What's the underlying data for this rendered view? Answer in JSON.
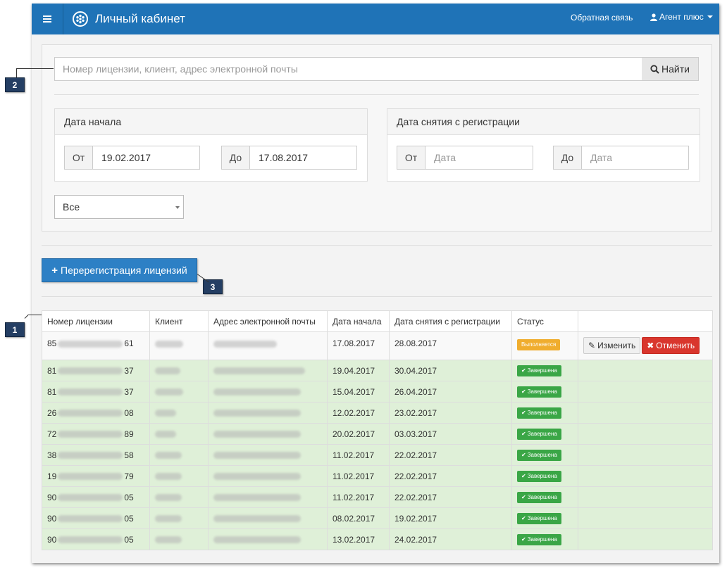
{
  "navbar": {
    "title": "Личный кабинет",
    "feedback": "Обратная связь",
    "user": "Агент плюс"
  },
  "search": {
    "placeholder": "Номер лицензии, клиент, адрес электронной почты",
    "button": "Найти"
  },
  "start_date": {
    "title": "Дата начала",
    "from_label": "От",
    "from_value": "19.02.2017",
    "to_label": "До",
    "to_value": "17.08.2017"
  },
  "dereg_date": {
    "title": "Дата снятия с регистрации",
    "from_label": "От",
    "from_placeholder": "Дата",
    "to_label": "До",
    "to_placeholder": "Дата"
  },
  "status_filter": {
    "value": "Все"
  },
  "rereg_button": "Перерегистрация лицензий",
  "table": {
    "headers": [
      "Номер лицензии",
      "Клиент",
      "Адрес электронной почты",
      "Дата начала",
      "Дата снятия с регистрации",
      "Статус",
      ""
    ],
    "rows": [
      {
        "lic_start": "85",
        "lic_end": "61",
        "start": "17.08.2017",
        "dereg": "28.08.2017",
        "status": "Выполняется",
        "state": "active"
      },
      {
        "lic_start": "81",
        "lic_end": "37",
        "start": "19.04.2017",
        "dereg": "30.04.2017",
        "status": "Завершена",
        "state": "done"
      },
      {
        "lic_start": "81",
        "lic_end": "37",
        "start": "15.04.2017",
        "dereg": "26.04.2017",
        "status": "Завершена",
        "state": "done"
      },
      {
        "lic_start": "26",
        "lic_end": "08",
        "start": "12.02.2017",
        "dereg": "23.02.2017",
        "status": "Завершена",
        "state": "done"
      },
      {
        "lic_start": "72",
        "lic_end": "89",
        "start": "20.02.2017",
        "dereg": "03.03.2017",
        "status": "Завершена",
        "state": "done"
      },
      {
        "lic_start": "38",
        "lic_end": "58",
        "start": "11.02.2017",
        "dereg": "22.02.2017",
        "status": "Завершена",
        "state": "done"
      },
      {
        "lic_start": "19",
        "lic_end": "79",
        "start": "11.02.2017",
        "dereg": "22.02.2017",
        "status": "Завершена",
        "state": "done"
      },
      {
        "lic_start": "90",
        "lic_end": "05",
        "start": "11.02.2017",
        "dereg": "22.02.2017",
        "status": "Завершена",
        "state": "done"
      },
      {
        "lic_start": "90",
        "lic_end": "05",
        "start": "08.02.2017",
        "dereg": "19.02.2017",
        "status": "Завершена",
        "state": "done"
      },
      {
        "lic_start": "90",
        "lic_end": "05",
        "start": "13.02.2017",
        "dereg": "24.02.2017",
        "status": "Завершена",
        "state": "done"
      }
    ],
    "edit_label": "Изменить",
    "cancel_label": "Отменить"
  },
  "callouts": [
    "1",
    "2",
    "3"
  ],
  "colors": {
    "navbar": "#1f73b7",
    "primary_button": "#2d80c5",
    "done_row": "#dff0d8",
    "done_badge": "#3aa646",
    "progress_badge": "#f0ad2e",
    "cancel_button": "#d9362d",
    "callout": "#243e63"
  }
}
